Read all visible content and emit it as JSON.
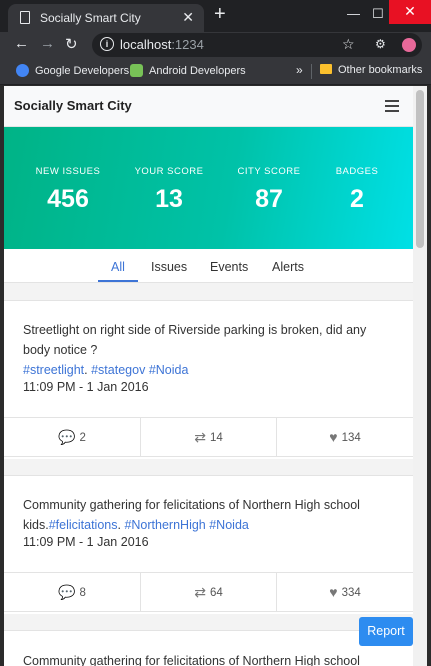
{
  "browser": {
    "tab_title": "Socially Smart City",
    "url_host": "localhost",
    "url_port": ":1234",
    "bookmarks": [
      "Google Developers",
      "Android Developers"
    ],
    "other_bookmarks": "Other bookmarks"
  },
  "app": {
    "brand": "Socially Smart City"
  },
  "stats": [
    {
      "label": "NEW ISSUES",
      "value": "456"
    },
    {
      "label": "YOUR SCORE",
      "value": "13"
    },
    {
      "label": "CITY SCORE",
      "value": "87"
    },
    {
      "label": "BADGES",
      "value": "2"
    }
  ],
  "tabs": [
    "All",
    "Issues",
    "Events",
    "Alerts"
  ],
  "active_tab": "All",
  "posts": [
    {
      "text": "Streetlight on right side of Riverside parking is broken, did any body notice ?",
      "tags": [
        "#streetlight",
        ". ",
        "#stategov",
        " ",
        "#Noida"
      ],
      "time": "11:09 PM - 1 Jan 2016",
      "comments": "2",
      "retweets": "14",
      "likes": "134"
    },
    {
      "text": "Community gathering for felicitations of Northern High school kids.",
      "tags": [
        "#felicitations",
        ". ",
        "#NorthernHigh",
        " ",
        "#Noida"
      ],
      "time": "11:09 PM - 1 Jan 2016",
      "comments": "8",
      "retweets": "64",
      "likes": "334"
    },
    {
      "text": "Community gathering for felicitations of Northern High school"
    }
  ],
  "report_button": "Report",
  "colors": {
    "hero_start": "#00b386",
    "hero_end": "#00e0e6",
    "accent": "#3d74d6",
    "report": "#2d8cf0"
  }
}
